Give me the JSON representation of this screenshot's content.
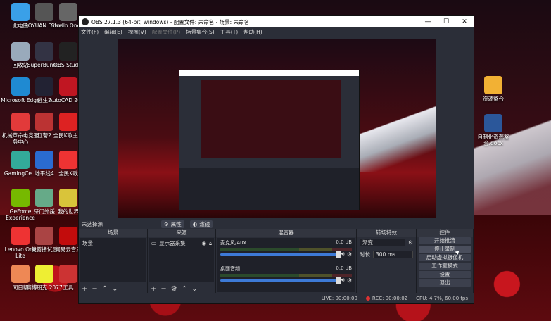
{
  "desktop": {
    "icons": [
      {
        "label": "此电脑",
        "color": "#3aa0e8"
      },
      {
        "label": "ROYUAN Driver",
        "color": "#555"
      },
      {
        "label": "Studio One 2",
        "color": "#666"
      },
      {
        "label": "回收站",
        "color": "#9ab"
      },
      {
        "label": "SuperBunn...",
        "color": "#334"
      },
      {
        "label": "OBS Studio",
        "color": "#222"
      },
      {
        "label": "Microsoft Edge",
        "color": "#1f8ad2"
      },
      {
        "label": "逃生2",
        "color": "#223"
      },
      {
        "label": "AutoCAD 2020",
        "color": "#c01622"
      },
      {
        "label": "机械革命电竞服务中心",
        "color": "#e23a3a"
      },
      {
        "label": "红警2",
        "color": "#b33"
      },
      {
        "label": "全民K歌主题",
        "color": "#d22"
      },
      {
        "label": "GamingCe...",
        "color": "#3a9"
      },
      {
        "label": "地平线4",
        "color": "#2a6bd0"
      },
      {
        "label": "全民K歌",
        "color": "#e33"
      },
      {
        "label": "GeForce Experience",
        "color": "#76b900"
      },
      {
        "label": "牙门外援",
        "color": "#6a8"
      },
      {
        "label": "我的世界",
        "color": "#d9c43a"
      },
      {
        "label": "Lenovo One Lite",
        "color": "#e33"
      },
      {
        "label": "裁剪接试后",
        "color": "#a44"
      },
      {
        "label": "网易云音乐",
        "color": "#c20c0c"
      },
      {
        "label": "同日帮",
        "color": "#e85"
      },
      {
        "label": "赛博朋克 2077",
        "color": "#ee3"
      },
      {
        "label": "工具",
        "color": "#c33"
      },
      {
        "label": "资源整合",
        "color": "#f2b134"
      },
      {
        "label": "自制化资源整合.docx",
        "color": "#2b579a"
      }
    ]
  },
  "obs": {
    "title": "OBS 27.1.3 (64-bit, windows) - 配置文件: 未命名 - 场景: 未命名",
    "window_buttons": [
      "—",
      "☐",
      "✕"
    ],
    "menu": [
      "文件(F)",
      "编辑(E)",
      "视图(V)",
      "配置文件(P)",
      "场景集合(S)",
      "工具(T)",
      "帮助(H)"
    ],
    "source_bar": {
      "selected": "未选择源",
      "properties": "属性",
      "filters": "滤镜"
    },
    "docks": {
      "scenes": {
        "title": "场景",
        "items": [
          "场景"
        ]
      },
      "sources": {
        "title": "来源",
        "items": [
          "显示器采集"
        ]
      },
      "mixer": {
        "title": "混音器",
        "tracks": [
          {
            "name": "麦克风/Aux",
            "db": "0.0 dB"
          },
          {
            "name": "桌面音频",
            "db": "0.0 dB"
          }
        ]
      },
      "transitions": {
        "title": "转场特效",
        "type": "渐变",
        "duration_label": "时长",
        "duration_value": "300 ms"
      },
      "controls": {
        "title": "控件",
        "buttons": [
          "开始推流",
          "停止录制",
          "启动虚拟摄像机",
          "工作室模式",
          "设置",
          "退出"
        ]
      }
    },
    "status": {
      "live": "LIVE: 00:00:00",
      "rec": "REC: 00:00:02",
      "cpu": "CPU: 4.7%, 60.00 fps"
    }
  }
}
